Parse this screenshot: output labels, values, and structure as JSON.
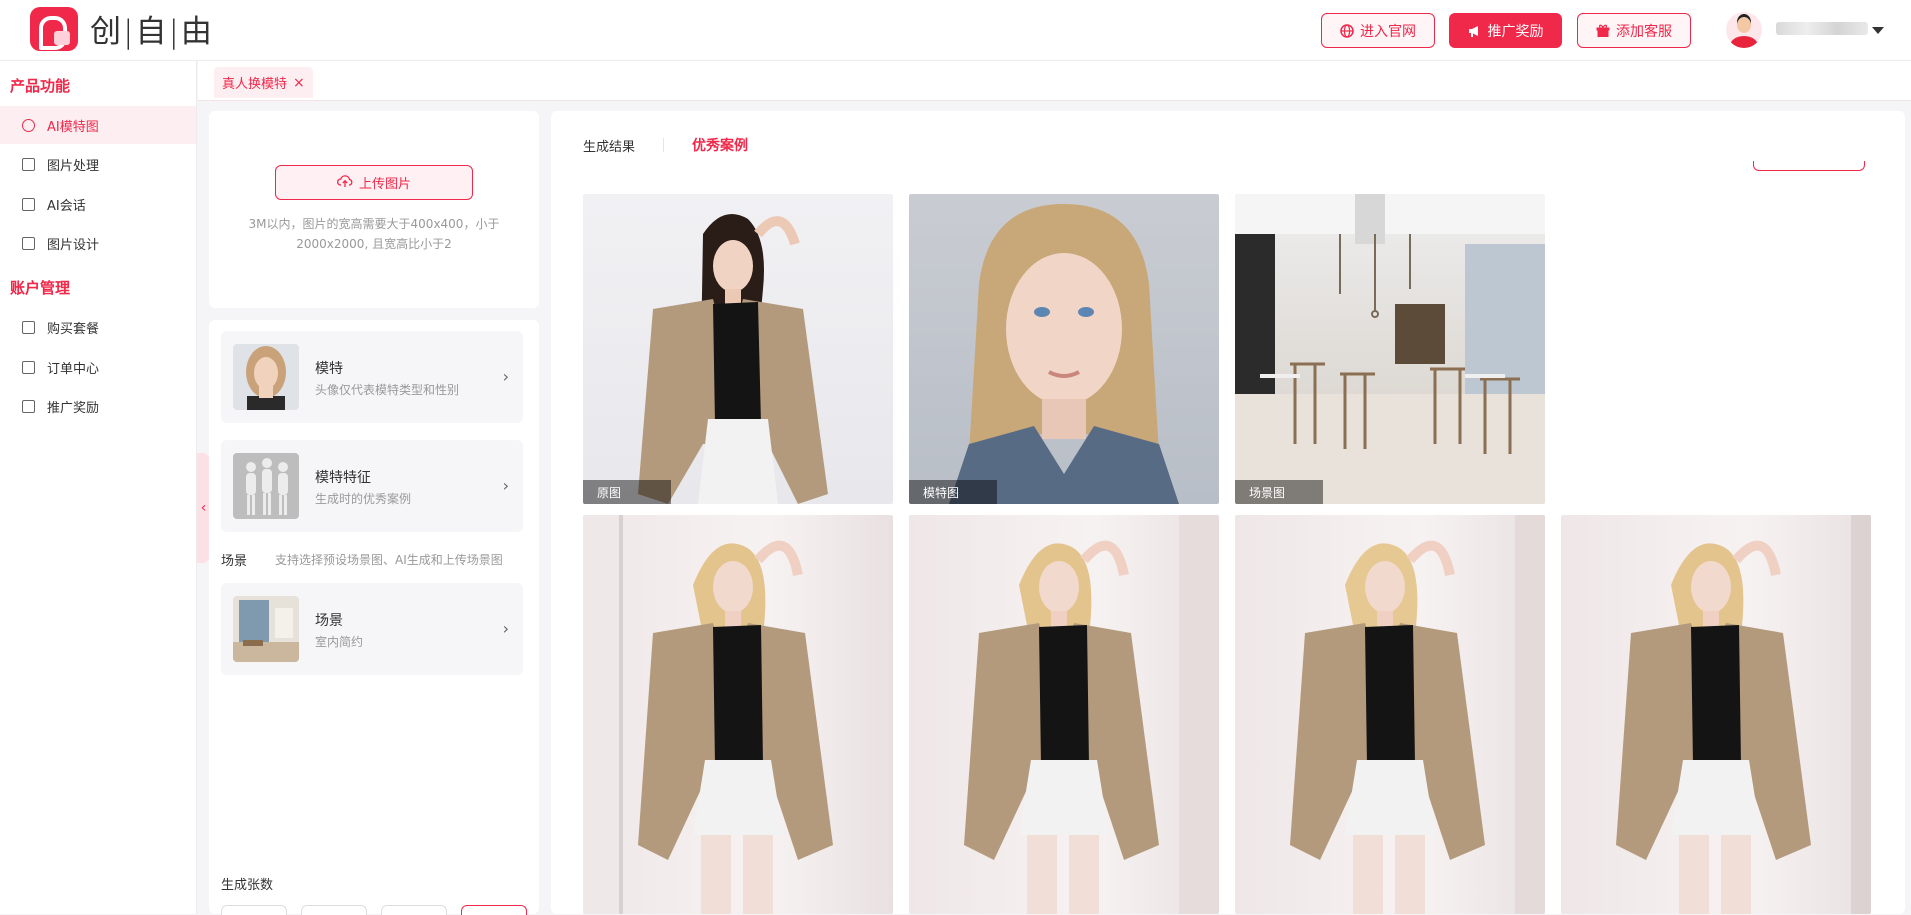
{
  "brand": {
    "name": "创|自|由"
  },
  "header": {
    "buttons": [
      {
        "label": "进入官网",
        "icon": "globe-icon",
        "style": "outline"
      },
      {
        "label": "推广奖励",
        "icon": "megaphone-icon",
        "style": "solid"
      },
      {
        "label": "添加客服",
        "icon": "gift-icon",
        "style": "outline"
      }
    ]
  },
  "sidebar": {
    "section1": "产品功能",
    "items1": [
      {
        "label": "AI模特图",
        "icon": "model-icon",
        "active": true
      },
      {
        "label": "图片处理",
        "icon": "image-icon"
      },
      {
        "label": "AI会话",
        "icon": "chat-icon"
      },
      {
        "label": "图片设计",
        "icon": "design-icon"
      }
    ],
    "section2": "账户管理",
    "items2": [
      {
        "label": "购买套餐",
        "icon": "cart-icon"
      },
      {
        "label": "订单中心",
        "icon": "order-icon"
      },
      {
        "label": "推广奖励",
        "icon": "megaphone-icon"
      }
    ]
  },
  "tabs": [
    {
      "label": "真人换模特",
      "close": "×"
    }
  ],
  "upload": {
    "button": "上传图片",
    "hint": "3M以内，图片的宽高需要大于400x400，小于2000x2000, 且宽高比小于2"
  },
  "options": [
    {
      "title": "模特",
      "subtitle": "头像仅代表模特类型和性别",
      "thumb": "model-portrait"
    },
    {
      "title": "模特特征",
      "subtitle": "生成时的优秀案例",
      "thumb": "mannequins"
    },
    {
      "title": "场景",
      "subtitle": "室内简约",
      "thumb": "room-scene"
    }
  ],
  "scene_section": {
    "label": "场景",
    "hint": "支持选择预设场景图、AI生成和上传场景图"
  },
  "count_label": "生成张数",
  "result_tabs": [
    {
      "label": "生成结果",
      "active": false
    },
    {
      "label": "优秀案例",
      "active": true
    }
  ],
  "gallery_top": [
    {
      "caption": "原图"
    },
    {
      "caption": "模特图"
    },
    {
      "caption": "场景图"
    }
  ],
  "colors": {
    "accent": "#f0284a",
    "accent_light": "#fdeef1"
  }
}
